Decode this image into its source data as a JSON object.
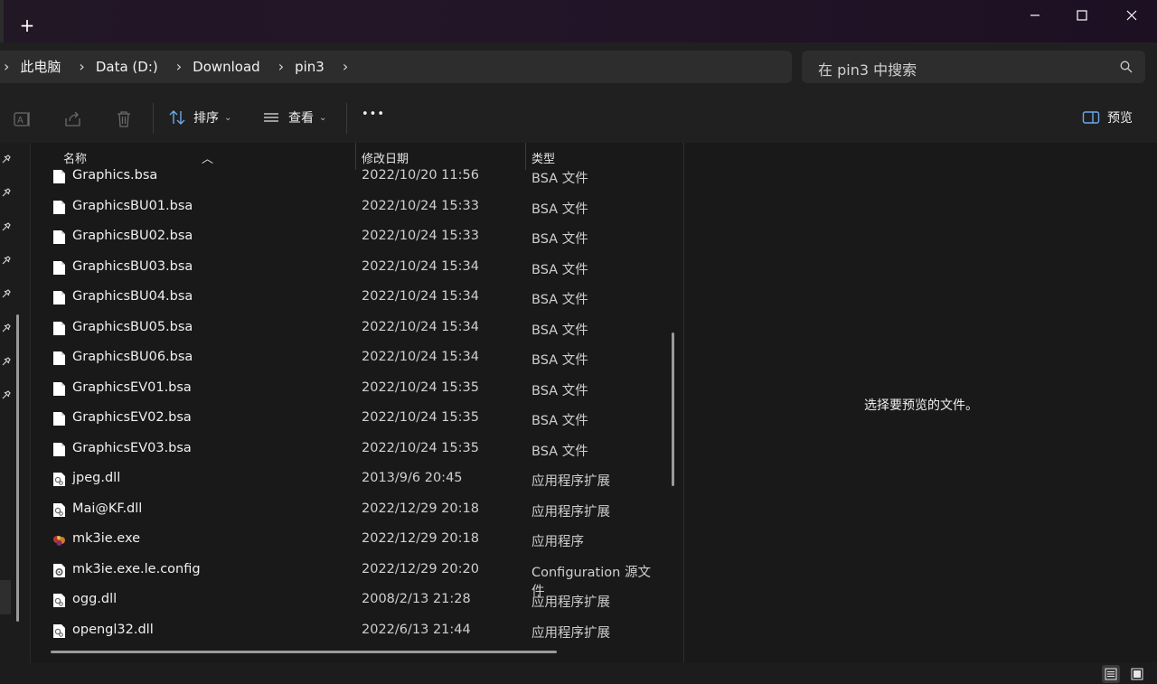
{
  "titlebar": {
    "new_tab_label": "+"
  },
  "window_controls": {
    "minimize_icon": "minimize-icon",
    "maximize_icon": "maximize-icon",
    "close_icon": "close-icon"
  },
  "breadcrumb": [
    {
      "label": "此电脑"
    },
    {
      "label": "Data (D:)"
    },
    {
      "label": "Download"
    },
    {
      "label": "pin3"
    }
  ],
  "search": {
    "placeholder": "在 pin3 中搜索"
  },
  "toolbar": {
    "sort_label": "排序",
    "view_label": "查看",
    "more_label": "•••",
    "preview_label": "预览"
  },
  "columns": {
    "name": "名称",
    "modified": "修改日期",
    "type": "类型"
  },
  "files": [
    {
      "name": "Graphics.bsa",
      "modified": "2022/10/20 11:56",
      "type": "BSA 文件",
      "icon": "file-icon"
    },
    {
      "name": "GraphicsBU01.bsa",
      "modified": "2022/10/24 15:33",
      "type": "BSA 文件",
      "icon": "file-icon"
    },
    {
      "name": "GraphicsBU02.bsa",
      "modified": "2022/10/24 15:33",
      "type": "BSA 文件",
      "icon": "file-icon"
    },
    {
      "name": "GraphicsBU03.bsa",
      "modified": "2022/10/24 15:34",
      "type": "BSA 文件",
      "icon": "file-icon"
    },
    {
      "name": "GraphicsBU04.bsa",
      "modified": "2022/10/24 15:34",
      "type": "BSA 文件",
      "icon": "file-icon"
    },
    {
      "name": "GraphicsBU05.bsa",
      "modified": "2022/10/24 15:34",
      "type": "BSA 文件",
      "icon": "file-icon"
    },
    {
      "name": "GraphicsBU06.bsa",
      "modified": "2022/10/24 15:34",
      "type": "BSA 文件",
      "icon": "file-icon"
    },
    {
      "name": "GraphicsEV01.bsa",
      "modified": "2022/10/24 15:35",
      "type": "BSA 文件",
      "icon": "file-icon"
    },
    {
      "name": "GraphicsEV02.bsa",
      "modified": "2022/10/24 15:35",
      "type": "BSA 文件",
      "icon": "file-icon"
    },
    {
      "name": "GraphicsEV03.bsa",
      "modified": "2022/10/24 15:35",
      "type": "BSA 文件",
      "icon": "file-icon"
    },
    {
      "name": "jpeg.dll",
      "modified": "2013/9/6 20:45",
      "type": "应用程序扩展",
      "icon": "dll-icon"
    },
    {
      "name": "Mai@KF.dll",
      "modified": "2022/12/29 20:18",
      "type": "应用程序扩展",
      "icon": "dll-icon"
    },
    {
      "name": "mk3ie.exe",
      "modified": "2022/12/29 20:18",
      "type": "应用程序",
      "icon": "exe-icon"
    },
    {
      "name": "mk3ie.exe.le.config",
      "modified": "2022/12/29 20:20",
      "type": "Configuration 源文件",
      "icon": "config-icon"
    },
    {
      "name": "ogg.dll",
      "modified": "2008/2/13 21:28",
      "type": "应用程序扩展",
      "icon": "dll-icon"
    },
    {
      "name": "opengl32.dll",
      "modified": "2022/6/13 21:44",
      "type": "应用程序扩展",
      "icon": "dll-icon"
    }
  ],
  "preview_pane": {
    "message": "选择要预览的文件。"
  },
  "colors": {
    "background": "#191919",
    "toolbar": "#202020",
    "input": "#2d2d2d"
  }
}
